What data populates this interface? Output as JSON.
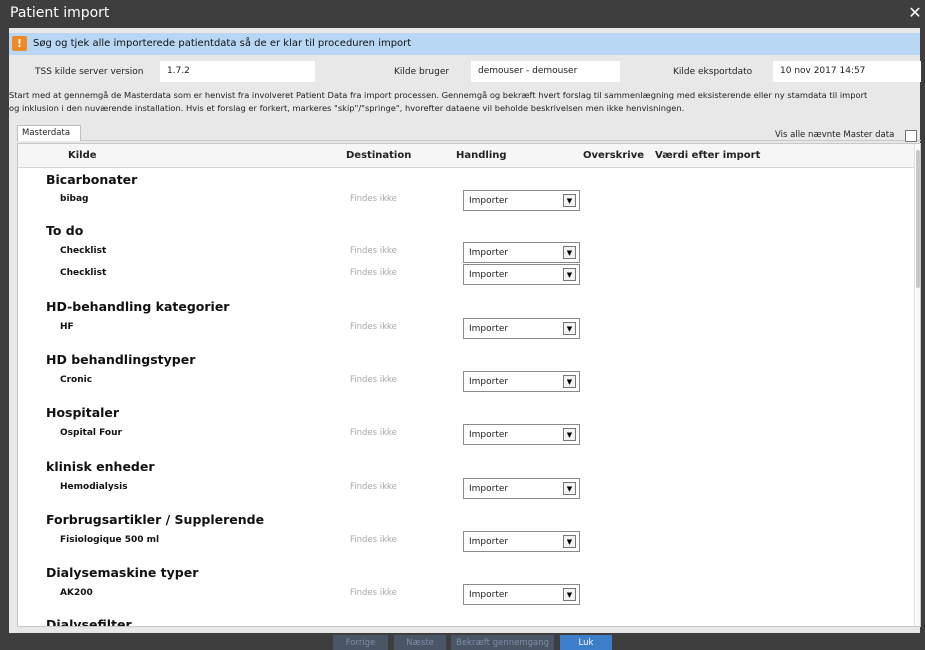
{
  "window": {
    "title": "Patient import"
  },
  "banner": {
    "message": "Søg og tjek alle importerede patientdata så de er klar til proceduren import"
  },
  "info": {
    "server_version_label": "TSS kilde server version",
    "server_version_value": "1.7.2",
    "source_user_label": "Kilde bruger",
    "source_user_value": "demouser - demouser",
    "export_date_label": "Kilde eksportdato",
    "export_date_value": "10 nov 2017 14:57"
  },
  "description": {
    "line1": "Start med at gennemgå de Masterdata som er henvist fra involveret Patient Data fra import processen. Gennemgå og bekræft hvert forslag til sammenlægning med eksisterende eller ny stamdata til import",
    "line2": "og inklusion i den nuværende installation. Hvis et forslag er forkert, markeres \"skip\"/\"springe\", hvorefter dataene vil beholde beskrivelsen men ikke henvisningen."
  },
  "tabs": {
    "masterdata": "Masterdata"
  },
  "show_all_label": "Vis alle nævnte Master data",
  "columns": {
    "kilde": "Kilde",
    "destination": "Destination",
    "handling": "Handling",
    "overskrive": "Overskrive",
    "vaerdi": "Værdi efter import"
  },
  "groups": [
    {
      "title": "Bicarbonater",
      "items": [
        {
          "name": "bibag",
          "destination": "Findes ikke",
          "action": "Importer"
        }
      ]
    },
    {
      "title": "To do",
      "items": [
        {
          "name": "Checklist",
          "destination": "Findes ikke",
          "action": "Importer"
        },
        {
          "name": "Checklist",
          "destination": "Findes ikke",
          "action": "Importer"
        }
      ]
    },
    {
      "title": "HD-behandling kategorier",
      "items": [
        {
          "name": "HF",
          "destination": "Findes ikke",
          "action": "Importer"
        }
      ]
    },
    {
      "title": "HD behandlingstyper",
      "items": [
        {
          "name": "Cronic",
          "destination": "Findes ikke",
          "action": "Importer"
        }
      ]
    },
    {
      "title": "Hospitaler",
      "items": [
        {
          "name": "Ospital Four",
          "destination": "Findes ikke",
          "action": "Importer"
        }
      ]
    },
    {
      "title": "klinisk enheder",
      "items": [
        {
          "name": "Hemodialysis",
          "destination": "Findes ikke",
          "action": "Importer"
        }
      ]
    },
    {
      "title": "Forbrugsartikler / Supplerende",
      "items": [
        {
          "name": "Fisiologique 500 ml",
          "destination": "Findes ikke",
          "action": "Importer"
        }
      ]
    },
    {
      "title": "Dialysemaskine typer",
      "items": [
        {
          "name": "AK200",
          "destination": "Findes ikke",
          "action": "Importer"
        }
      ]
    },
    {
      "title": "Dialysefilter",
      "items": []
    }
  ],
  "footer": {
    "prev": "Forrige",
    "next": "Næste",
    "confirm": "Bekræft gennemgang",
    "close": "Luk"
  }
}
